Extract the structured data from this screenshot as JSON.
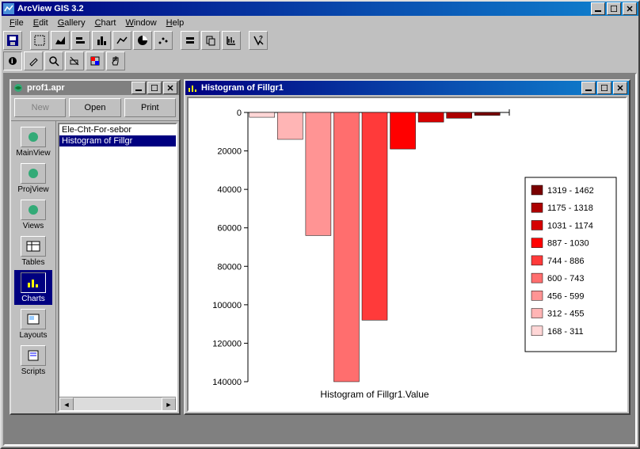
{
  "app": {
    "title": "ArcView GIS 3.2"
  },
  "menu": {
    "file": "File",
    "edit": "Edit",
    "gallery": "Gallery",
    "chart": "Chart",
    "window": "Window",
    "help": "Help"
  },
  "project": {
    "title": "prof1.apr",
    "btn_new": "New",
    "btn_open": "Open",
    "btn_print": "Print",
    "cats": {
      "mainview": "MainView",
      "projview": "ProjView",
      "views": "Views",
      "tables": "Tables",
      "charts": "Charts",
      "layouts": "Layouts",
      "scripts": "Scripts"
    },
    "items": [
      "Ele-Cht-For-sebor",
      "Histogram of Fillgr"
    ]
  },
  "chartwin": {
    "title": "Histogram of Fillgr1"
  },
  "chart_data": {
    "type": "bar",
    "title": "Histogram of Fillgr1.Value",
    "xlabel": "",
    "ylabel": "",
    "ylim": [
      0,
      140000
    ],
    "yticks": [
      0,
      20000,
      40000,
      60000,
      80000,
      100000,
      120000,
      140000
    ],
    "categories": [
      "168 - 311",
      "312 - 455",
      "456 - 599",
      "600 - 743",
      "744 - 886",
      "887 - 1030",
      "1031 - 1174",
      "1175 - 1318",
      "1319 - 1462"
    ],
    "values": [
      2500,
      14000,
      64000,
      140000,
      108000,
      19000,
      5000,
      3000,
      1500
    ],
    "colors": [
      "#ffd6d6",
      "#ffb5b5",
      "#ff9494",
      "#ff6e6e",
      "#ff3a3a",
      "#ff0000",
      "#d60000",
      "#ad0000",
      "#7a0000"
    ],
    "legend": [
      "168 - 311",
      "312 - 455",
      "456 - 599",
      "600 - 743",
      "744 - 886",
      "887 - 1030",
      "1031 - 1174",
      "1175 - 1318",
      "1319 - 1462"
    ]
  }
}
